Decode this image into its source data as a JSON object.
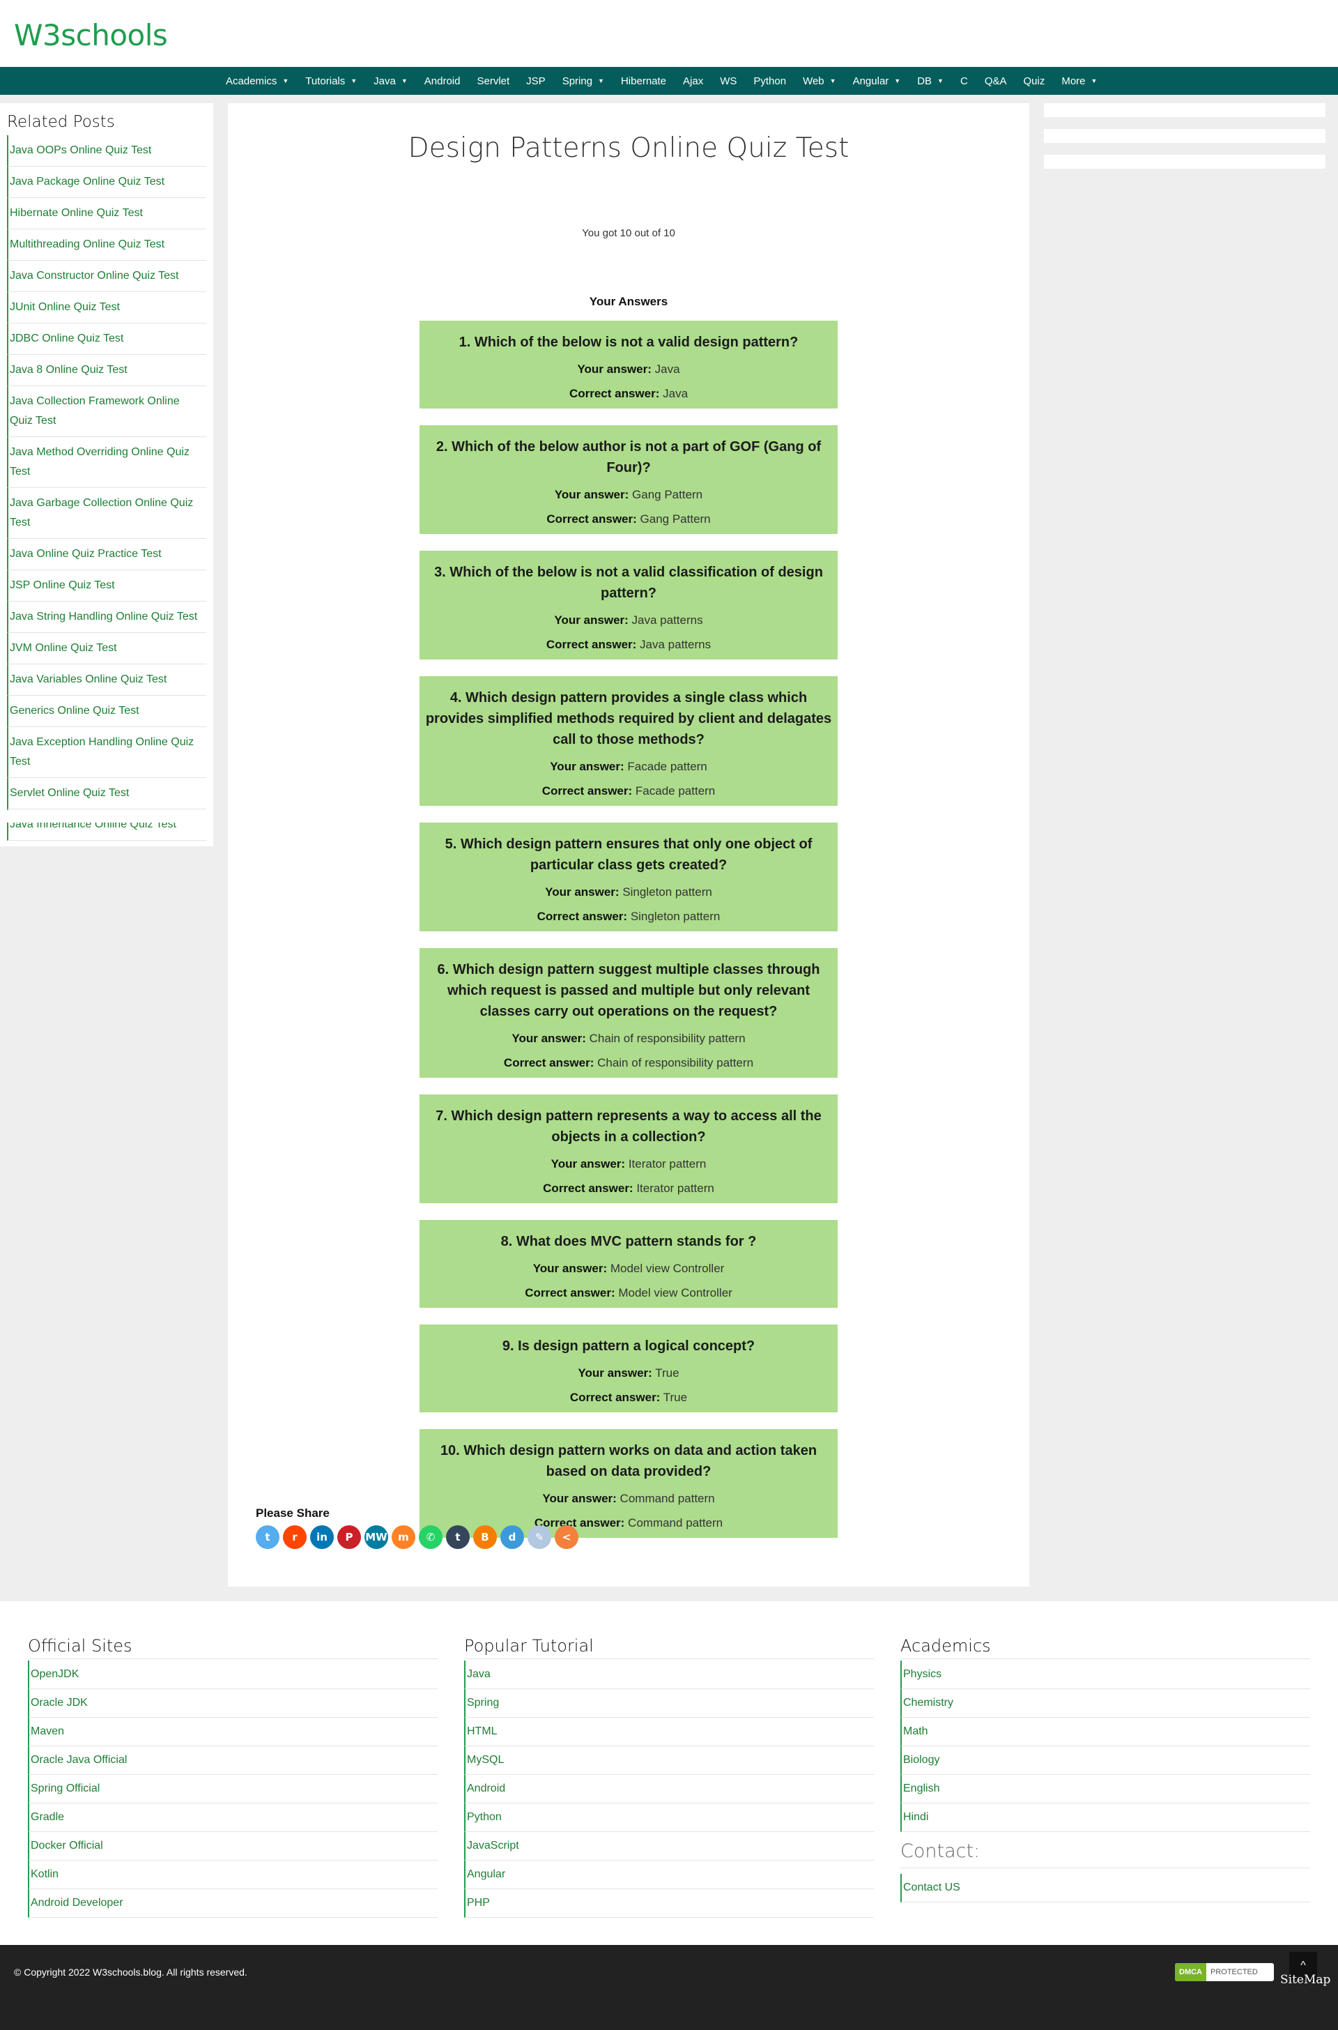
{
  "site": {
    "logo": "W3schools"
  },
  "nav": [
    {
      "label": "Academics",
      "dropdown": true
    },
    {
      "label": "Tutorials",
      "dropdown": true
    },
    {
      "label": "Java",
      "dropdown": true
    },
    {
      "label": "Android",
      "dropdown": false
    },
    {
      "label": "Servlet",
      "dropdown": false
    },
    {
      "label": "JSP",
      "dropdown": false
    },
    {
      "label": "Spring",
      "dropdown": true
    },
    {
      "label": "Hibernate",
      "dropdown": false
    },
    {
      "label": "Ajax",
      "dropdown": false
    },
    {
      "label": "WS",
      "dropdown": false
    },
    {
      "label": "Python",
      "dropdown": false
    },
    {
      "label": "Web",
      "dropdown": true
    },
    {
      "label": "Angular",
      "dropdown": true
    },
    {
      "label": "DB",
      "dropdown": true
    },
    {
      "label": "C",
      "dropdown": false
    },
    {
      "label": "Q&A",
      "dropdown": false
    },
    {
      "label": "Quiz",
      "dropdown": false
    },
    {
      "label": "More",
      "dropdown": true
    }
  ],
  "sidebar": {
    "title": "Related Posts",
    "items": [
      "Java OOPs Online Quiz Test",
      "Java Package Online Quiz Test",
      "Hibernate Online Quiz Test",
      "Multithreading Online Quiz Test",
      "Java Constructor Online Quiz Test",
      "JUnit Online Quiz Test",
      "JDBC Online Quiz Test",
      "Java 8 Online Quiz Test",
      "Java Collection Framework Online Quiz Test",
      "Java Method Overriding Online Quiz Test",
      "Java Garbage Collection Online Quiz Test",
      "Java Online Quiz Practice Test",
      "JSP Online Quiz Test",
      "Java String Handling Online Quiz Test",
      "JVM Online Quiz Test",
      "Java Variables Online Quiz Test",
      "Generics Online Quiz Test",
      "Java Exception Handling Online Quiz Test",
      "Servlet Online Quiz Test",
      "Java Inheritance Online Quiz Test"
    ]
  },
  "main": {
    "title": "Design Patterns Online Quiz Test",
    "score": "You got 10 out of 10",
    "answers_heading": "Your Answers",
    "your_answer_label": "Your answer:",
    "correct_answer_label": "Correct answer:",
    "answer_bg": "#acdc8c",
    "questions": [
      {
        "q": "1. Which of the below is not a valid design pattern?",
        "yours": "Java",
        "correct": "Java"
      },
      {
        "q": "2. Which of the below author is not a part of GOF (Gang of Four)?",
        "yours": "Gang Pattern",
        "correct": "Gang Pattern"
      },
      {
        "q": "3. Which of the below is not a valid classification of design pattern?",
        "yours": "Java patterns",
        "correct": "Java patterns"
      },
      {
        "q": "4. Which design pattern provides a single class which provides simplified methods required by client and delagates call to those methods?",
        "yours": "Facade pattern",
        "correct": "Facade pattern"
      },
      {
        "q": "5. Which design pattern ensures that only one object of particular class gets created?",
        "yours": "Singleton pattern",
        "correct": "Singleton pattern"
      },
      {
        "q": "6. Which design pattern suggest multiple classes through which request is passed and multiple but only relevant classes carry out operations on the request?",
        "yours": "Chain of responsibility pattern",
        "correct": "Chain of responsibility pattern"
      },
      {
        "q": "7. Which design pattern represents a way to access all the objects in a collection?",
        "yours": "Iterator pattern",
        "correct": "Iterator pattern"
      },
      {
        "q": "8. What does MVC pattern stands for ?",
        "yours": "Model view Controller",
        "correct": "Model view Controller"
      },
      {
        "q": "9. Is design pattern a logical concept?",
        "yours": "True",
        "correct": "True"
      },
      {
        "q": "10. Which design pattern works on data and action taken based on data provided?",
        "yours": "Command pattern",
        "correct": "Command pattern"
      }
    ],
    "share_label": "Please Share",
    "share_buttons": [
      {
        "name": "twitter-icon",
        "glyph": "t",
        "color": "#55acee"
      },
      {
        "name": "reddit-icon",
        "glyph": "r",
        "color": "#ff4500"
      },
      {
        "name": "linkedin-icon",
        "glyph": "in",
        "color": "#0077b5"
      },
      {
        "name": "pinterest-icon",
        "glyph": "P",
        "color": "#cb2027"
      },
      {
        "name": "mewe-icon",
        "glyph": "MW",
        "color": "#007da1"
      },
      {
        "name": "mix-icon",
        "glyph": "m",
        "color": "#ff8226"
      },
      {
        "name": "whatsapp-icon",
        "glyph": "✆",
        "color": "#25d366"
      },
      {
        "name": "tumblr-icon",
        "glyph": "t",
        "color": "#35465c"
      },
      {
        "name": "blogger-icon",
        "glyph": "B",
        "color": "#f57d00"
      },
      {
        "name": "diaspora-icon",
        "glyph": "d",
        "color": "#3d9ad9"
      },
      {
        "name": "edit-icon",
        "glyph": "✎",
        "color": "#b2c8e0"
      },
      {
        "name": "more-share-icon",
        "glyph": "<",
        "color": "#f3813c"
      }
    ]
  },
  "footer": {
    "official": {
      "title": "Official Sites",
      "items": [
        "OpenJDK",
        "Oracle JDK",
        "Maven",
        "Oracle Java Official",
        "Spring Official",
        "Gradle",
        "Docker Official",
        "Kotlin",
        "Android Developer"
      ]
    },
    "popular": {
      "title": "Popular Tutorial",
      "items": [
        "Java",
        "Spring",
        "HTML",
        "MySQL",
        "Android",
        "Python",
        "JavaScript",
        "Angular",
        "PHP"
      ]
    },
    "academics": {
      "title": "Academics",
      "items": [
        "Physics",
        "Chemistry",
        "Math",
        "Biology",
        "English",
        "Hindi"
      ]
    },
    "contact": {
      "title": "Contact:",
      "items": [
        "Contact US"
      ]
    },
    "copyright": "© Copyright 2022 W3schools.blog. All rights reserved.",
    "dmca_badge": "DMCA",
    "dmca_text": "PROTECTED",
    "back_to_top": "^",
    "sitemap": "SiteMap"
  }
}
